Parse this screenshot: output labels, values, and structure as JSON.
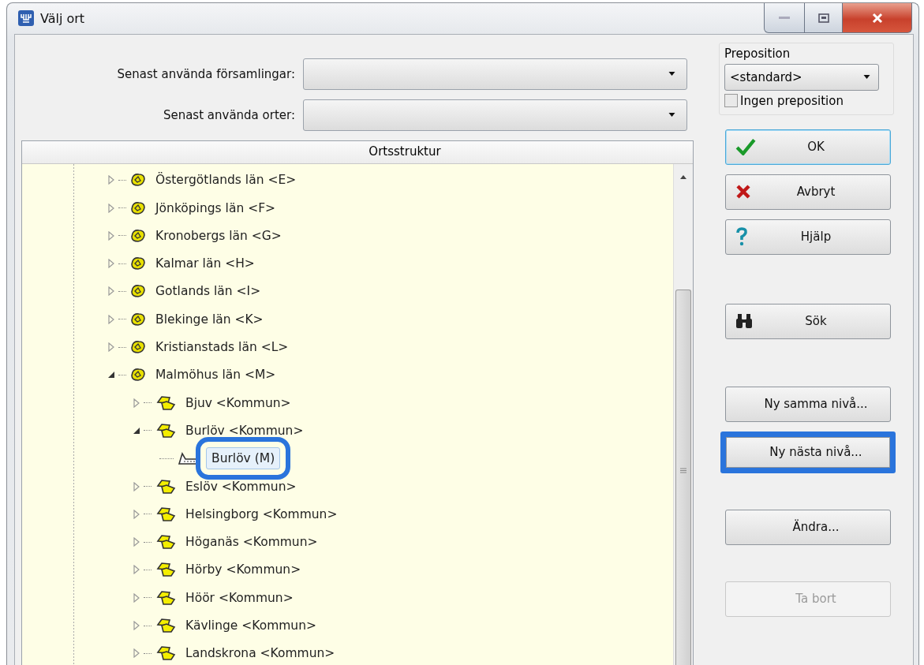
{
  "window": {
    "title": "Välj ort"
  },
  "recent": [
    {
      "label": "Senast använda församlingar:"
    },
    {
      "label": "Senast använda orter:"
    }
  ],
  "preposition": {
    "legend": "Preposition",
    "value": "<standard>",
    "checkbox": {
      "label": "Ingen preposition",
      "checked": false
    }
  },
  "tree": {
    "header": "Ortsstruktur",
    "items": [
      {
        "kind": "county",
        "label": "Östergötlands län <E>",
        "expanded": false,
        "selected": false
      },
      {
        "kind": "county",
        "label": "Jönköpings län <F>",
        "expanded": false,
        "selected": false
      },
      {
        "kind": "county",
        "label": "Kronobergs län <G>",
        "expanded": false,
        "selected": false
      },
      {
        "kind": "county",
        "label": "Kalmar län <H>",
        "expanded": false,
        "selected": false
      },
      {
        "kind": "county",
        "label": "Gotlands län <I>",
        "expanded": false,
        "selected": false
      },
      {
        "kind": "county",
        "label": "Blekinge län <K>",
        "expanded": false,
        "selected": false
      },
      {
        "kind": "county",
        "label": "Kristianstads län <L>",
        "expanded": false,
        "selected": false
      },
      {
        "kind": "county",
        "label": "Malmöhus län <M>",
        "expanded": true,
        "selected": false,
        "children": [
          {
            "kind": "municipality",
            "label": "Bjuv <Kommun>",
            "expanded": false,
            "selected": false
          },
          {
            "kind": "municipality",
            "label": "Burlöv <Kommun>",
            "expanded": true,
            "selected": false,
            "children": [
              {
                "kind": "place",
                "label": "Burlöv (M)",
                "selected": true,
                "highlighted": true
              }
            ]
          },
          {
            "kind": "municipality",
            "label": "Eslöv <Kommun>",
            "expanded": false,
            "selected": false
          },
          {
            "kind": "municipality",
            "label": "Helsingborg <Kommun>",
            "expanded": false,
            "selected": false
          },
          {
            "kind": "municipality",
            "label": "Höganäs <Kommun>",
            "expanded": false,
            "selected": false
          },
          {
            "kind": "municipality",
            "label": "Hörby <Kommun>",
            "expanded": false,
            "selected": false
          },
          {
            "kind": "municipality",
            "label": "Höör <Kommun>",
            "expanded": false,
            "selected": false
          },
          {
            "kind": "municipality",
            "label": "Kävlinge <Kommun>",
            "expanded": false,
            "selected": false
          },
          {
            "kind": "municipality",
            "label": "Landskrona <Kommun>",
            "expanded": false,
            "selected": false
          }
        ]
      }
    ]
  },
  "buttons": [
    {
      "kind": "ok",
      "label": "OK",
      "disabled": false,
      "highlighted": false
    },
    {
      "kind": "cancel",
      "label": "Avbryt",
      "disabled": false,
      "highlighted": false
    },
    {
      "kind": "help",
      "label": "Hjälp",
      "disabled": false,
      "highlighted": false
    },
    {
      "kind": "search",
      "label": "Sök",
      "disabled": false,
      "highlighted": false
    },
    {
      "kind": "plain",
      "label": "Ny samma nivå...",
      "disabled": false,
      "highlighted": false
    },
    {
      "kind": "plain",
      "label": "Ny nästa nivå...",
      "disabled": false,
      "highlighted": true
    },
    {
      "kind": "plain",
      "label": "Ändra...",
      "disabled": false,
      "highlighted": false
    },
    {
      "kind": "plain",
      "label": "Ta bort",
      "disabled": true,
      "highlighted": false
    }
  ]
}
